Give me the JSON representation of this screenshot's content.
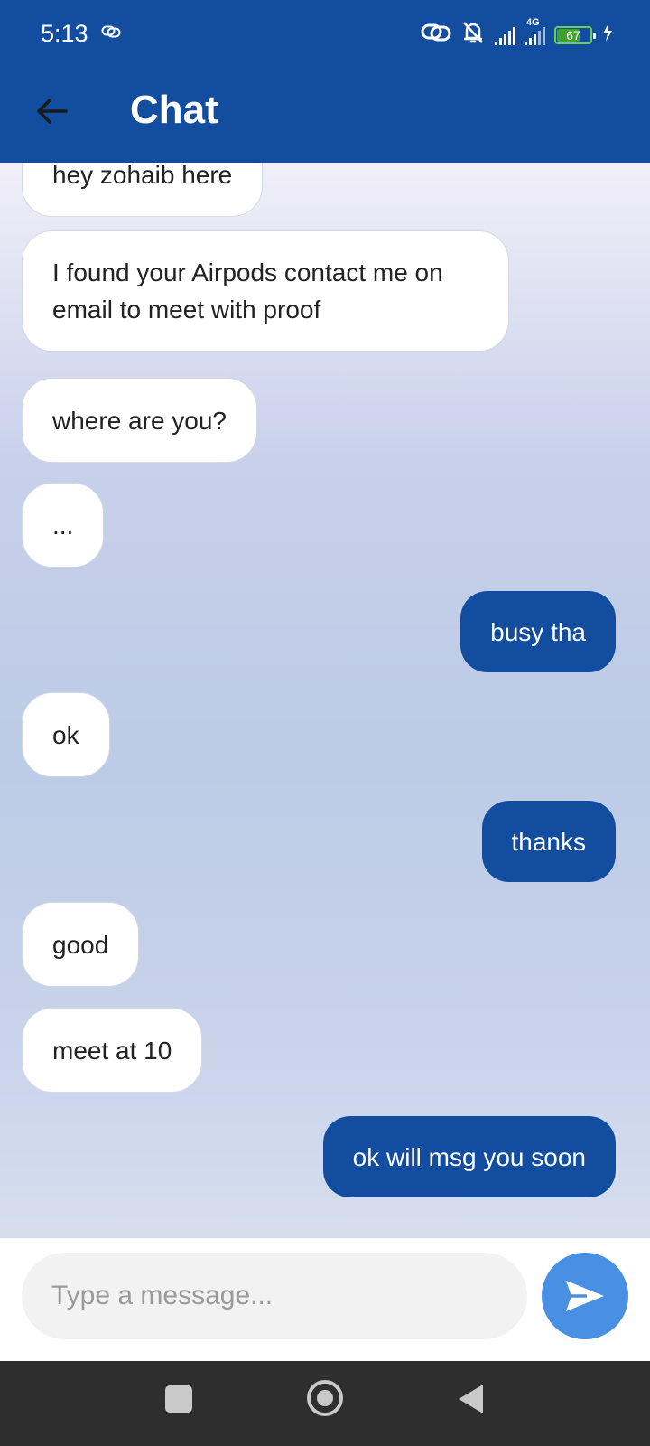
{
  "status_bar": {
    "time": "5:13",
    "network_label": "4G",
    "battery": "67",
    "battery_level": 0.67
  },
  "header": {
    "title": "Chat"
  },
  "messages": [
    {
      "text": "hey zohaib here",
      "direction": "incoming"
    },
    {
      "text": "I found your Airpods contact me on email to meet with proof",
      "direction": "incoming"
    },
    {
      "text": "where are you?",
      "direction": "incoming"
    },
    {
      "text": "...",
      "direction": "incoming"
    },
    {
      "text": "busy tha",
      "direction": "outgoing"
    },
    {
      "text": "ok",
      "direction": "incoming"
    },
    {
      "text": "thanks",
      "direction": "outgoing"
    },
    {
      "text": "good",
      "direction": "incoming"
    },
    {
      "text": "meet at 10",
      "direction": "incoming"
    },
    {
      "text": "ok will msg you soon",
      "direction": "outgoing"
    }
  ],
  "composer": {
    "placeholder": "Type a message...",
    "value": ""
  },
  "icons": {
    "back": "arrow-left-icon",
    "send": "send-icon",
    "link": "link-icon",
    "mute": "bell-off-icon",
    "recent": "square-icon",
    "home": "circle-icon",
    "nav_back": "triangle-back-icon"
  },
  "colors": {
    "primary": "#134da0",
    "send_button": "#4a90e2",
    "incoming_bubble": "#ffffff",
    "outgoing_bubble": "#134da0",
    "navbar": "#2e2e2e",
    "battery": "#6bd14b"
  }
}
